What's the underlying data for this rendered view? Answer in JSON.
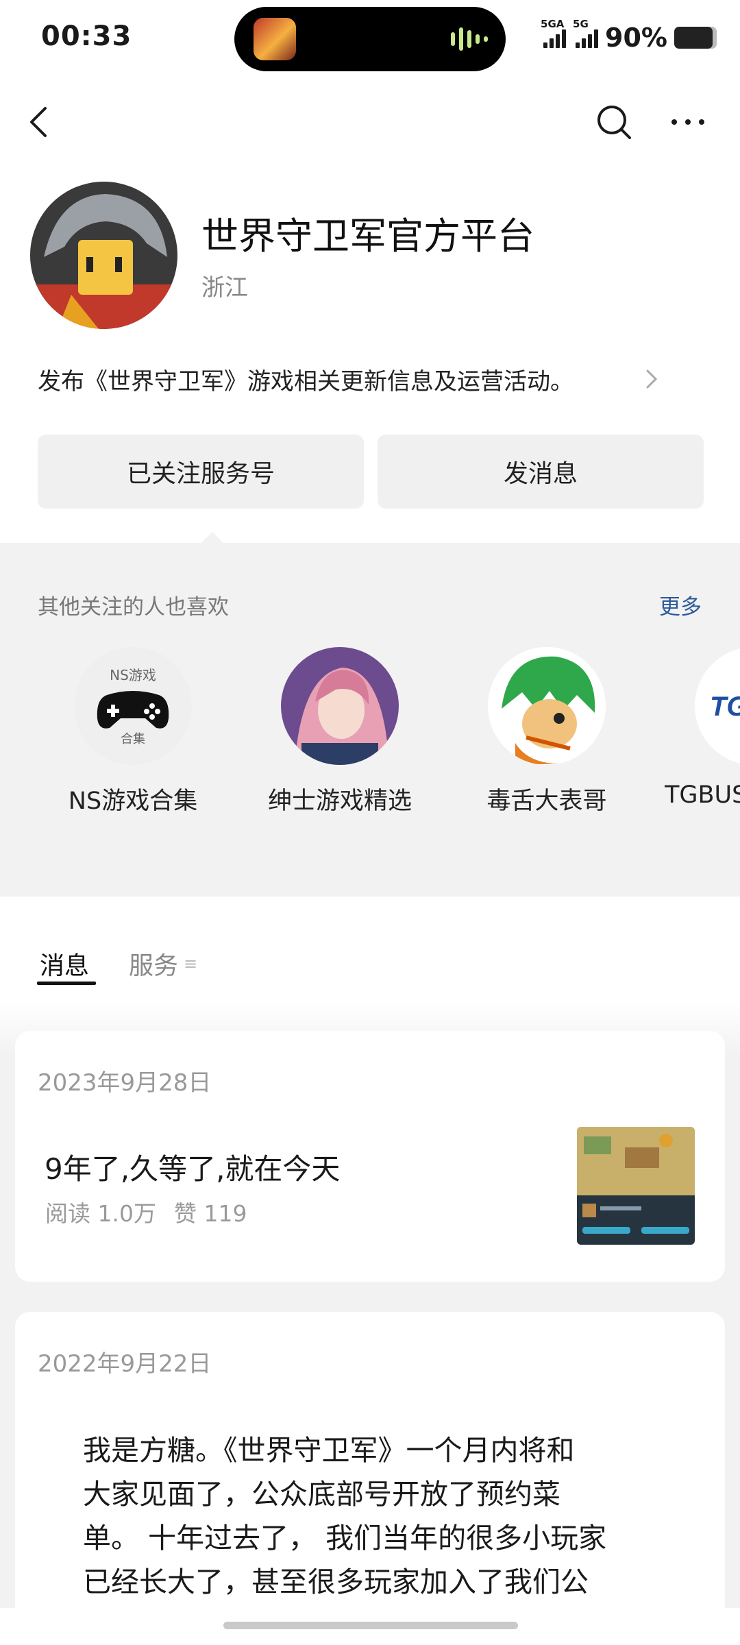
{
  "status_bar": {
    "time": "00:33",
    "network1": "5GA",
    "network2": "5G",
    "battery": "90%",
    "battery_level": 0.9
  },
  "nav": {
    "back_icon": "chevron-left-icon",
    "search_icon": "search-icon",
    "more_icon": "more-horizontal-icon"
  },
  "profile": {
    "name": "世界守卫军官方平台",
    "region": "浙江",
    "description": "发布《世界守卫军》游戏相关更新信息及运营活动。"
  },
  "actions": {
    "followed_label": "已关注服务号",
    "message_label": "发消息"
  },
  "recommend": {
    "title": "其他关注的人也喜欢",
    "more_label": "更多",
    "items": [
      {
        "name": "NS游戏合集",
        "avatar_top": "NS游戏",
        "avatar_bottom": "合集"
      },
      {
        "name": "绅士游戏精选"
      },
      {
        "name": "毒舌大表哥"
      },
      {
        "name": "TGBUS",
        "avatar_text": "TG"
      }
    ]
  },
  "tabs": {
    "messages": "消息",
    "services": "服务"
  },
  "posts": [
    {
      "date": "2023年9月28日",
      "title": "9年了,久等了,就在今天",
      "reads": "阅读 1.0万",
      "likes": "赞 119"
    },
    {
      "date": "2022年9月22日",
      "lines": [
        "我是方糖。《世界守卫军》一个月内将和",
        "大家见面了，公众底部号开放了预约菜",
        "单。 十年过去了， 我们当年的很多小玩家",
        "已经长大了，甚至很多玩家加入了我们公"
      ]
    }
  ],
  "colors": {
    "accent_link": "#2b5a9c",
    "section_bg": "#f2f2f2",
    "button_bg": "#f0f0f0"
  }
}
